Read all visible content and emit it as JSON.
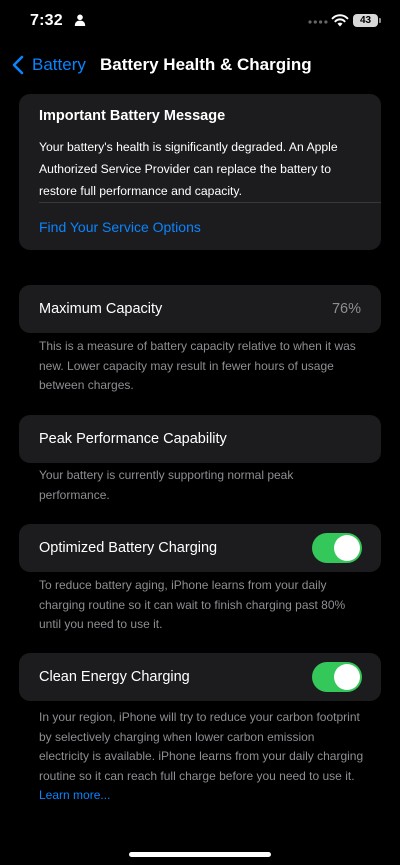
{
  "status_bar": {
    "time": "7:32",
    "battery_level": "43"
  },
  "nav": {
    "back_label": "Battery",
    "title": "Battery Health & Charging"
  },
  "message_card": {
    "title": "Important Battery Message",
    "body": "Your battery's health is significantly degraded. An Apple Authorized Service Provider can replace the battery to restore full performance and capacity.",
    "link": "Find Your Service Options"
  },
  "maximum_capacity": {
    "label": "Maximum Capacity",
    "value": "76%",
    "footnote": "This is a measure of battery capacity relative to when it was new. Lower capacity may result in fewer hours of usage between charges."
  },
  "peak_performance": {
    "label": "Peak Performance Capability",
    "footnote": "Your battery is currently supporting normal peak performance."
  },
  "optimized_charging": {
    "label": "Optimized Battery Charging",
    "enabled": true,
    "footnote": "To reduce battery aging, iPhone learns from your daily charging routine so it can wait to finish charging past 80% until you need to use it."
  },
  "clean_energy": {
    "label": "Clean Energy Charging",
    "enabled": true,
    "footnote": "In your region, iPhone will try to reduce your carbon footprint by selectively charging when lower carbon emission electricity is available. iPhone learns from your daily charging routine so it can reach full charge before you need to use it.",
    "learn_more": "Learn more..."
  },
  "colors": {
    "accent": "#0a84ff",
    "toggle_on": "#34c759",
    "card_bg": "#1c1c1e",
    "footnote": "#8e8e93"
  }
}
